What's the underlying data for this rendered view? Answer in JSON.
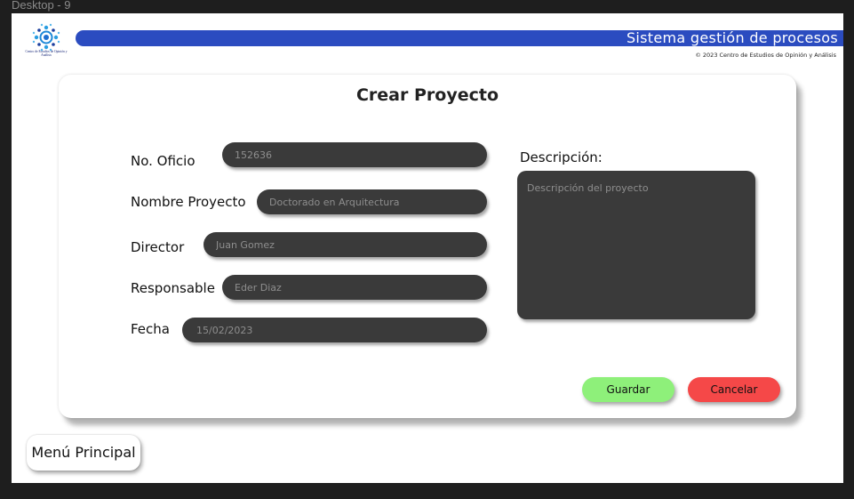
{
  "frame": {
    "label": "Desktop - 9"
  },
  "header": {
    "logo_caption": "Centro de Estudios de Opinión y Análisis",
    "system_title": "Sistema gestión de procesos",
    "copyright": "© 2023 Centro de Estudios de Opinión y Análisis",
    "accent_color": "#2b4cc0"
  },
  "form": {
    "title": "Crear Proyecto",
    "fields": {
      "oficio": {
        "label": "No. Oficio",
        "placeholder": "152636"
      },
      "nombre": {
        "label": "Nombre Proyecto",
        "placeholder": "Doctorado en Arquitectura"
      },
      "director": {
        "label": "Director",
        "placeholder": "Juan Gomez"
      },
      "responsable": {
        "label": "Responsable",
        "placeholder": "Eder Diaz"
      },
      "fecha": {
        "label": "Fecha",
        "placeholder": "15/02/2023"
      },
      "descripcion": {
        "label": "Descripción:",
        "placeholder": "Descripción del proyecto"
      }
    },
    "buttons": {
      "save_label": "Guardar",
      "save_color": "#8ef07a",
      "cancel_label": "Cancelar",
      "cancel_color": "#f54848"
    }
  },
  "nav": {
    "menu_label": "Menú Principal"
  }
}
